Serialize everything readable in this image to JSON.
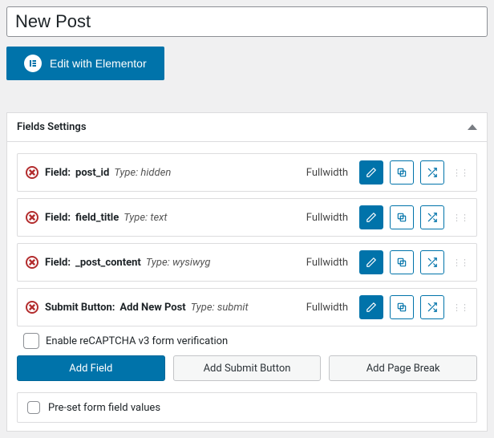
{
  "title": "New Post",
  "elementor_label": "Edit with Elementor",
  "panel_title": "Fields Settings",
  "labels": {
    "field_prefix": "Field:",
    "submit_prefix": "Submit Button:",
    "type_prefix": "Type:",
    "fullwidth": "Fullwidth"
  },
  "fields": [
    {
      "kind": "field",
      "name": "post_id",
      "type": "hidden"
    },
    {
      "kind": "field",
      "name": "field_title",
      "type": "text"
    },
    {
      "kind": "field",
      "name": "_post_content",
      "type": "wysiwyg"
    },
    {
      "kind": "submit",
      "name": "Add New Post",
      "type": "submit"
    }
  ],
  "recaptcha_label": "Enable reCAPTCHA v3 form verification",
  "buttons": {
    "add_field": "Add Field",
    "add_submit": "Add Submit Button",
    "add_break": "Add Page Break"
  },
  "preset_label": "Pre-set form field values"
}
